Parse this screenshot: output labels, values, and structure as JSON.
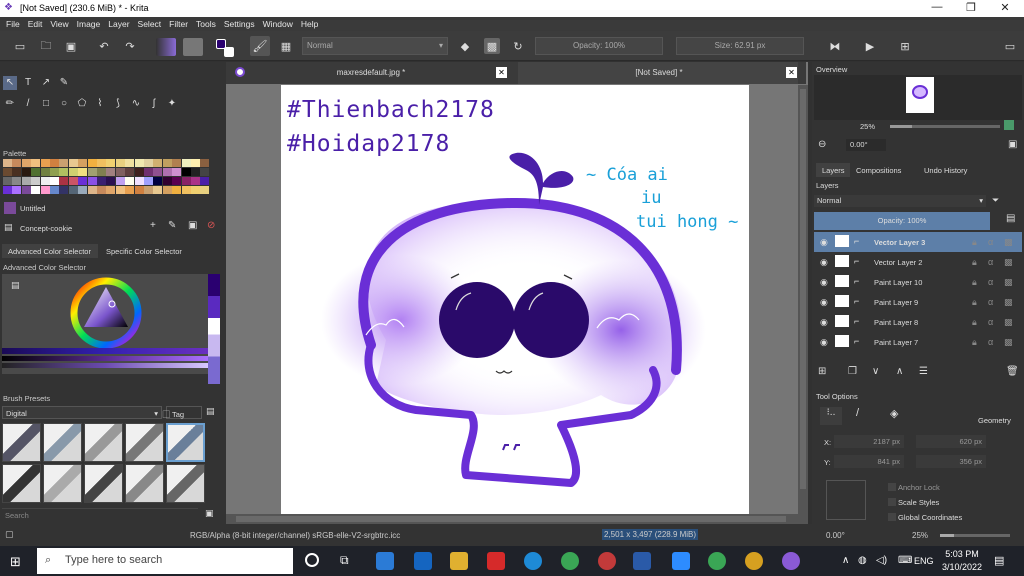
{
  "window": {
    "title": "[Not Saved]  (230.6 MiB)  * - Krita"
  },
  "menu": [
    "File",
    "Edit",
    "View",
    "Image",
    "Layer",
    "Select",
    "Filter",
    "Tools",
    "Settings",
    "Window",
    "Help"
  ],
  "toolbar": {
    "blend_mode": "Normal",
    "opacity": "Opacity: 100%",
    "size": "Size: 62.91 px"
  },
  "docker_palette": {
    "title": "Palette",
    "palette_name": "Untitled",
    "resource": "Concept-cookie"
  },
  "color_selector": {
    "tab1": "Advanced Color Selector",
    "tab2": "Specific Color Selector",
    "title": "Advanced Color Selector"
  },
  "brush_presets": {
    "title": "Brush Presets",
    "filter": "Digital",
    "tag": "Tag",
    "search": "Search"
  },
  "doc_tabs": [
    "maxresdefault.jpg *",
    "[Not Saved]  *"
  ],
  "artwork": {
    "line1": "#Thienbach2178",
    "line2": "#Hoidap2178",
    "line3": "~ Cóa ai",
    "line4": "iu",
    "line5": "tui hong ~"
  },
  "overview": {
    "title": "Overview",
    "zoom": "25%",
    "rotation": "0.00°"
  },
  "layers_panel": {
    "tabs": [
      "Layers",
      "Compositions",
      "Undo History"
    ],
    "title": "Layers",
    "blend": "Normal",
    "opacity": "Opacity:  100%",
    "layers": [
      {
        "name": "Vector Layer 3",
        "selected": true
      },
      {
        "name": "Vector Layer 2",
        "selected": false
      },
      {
        "name": "Paint Layer 10",
        "selected": false
      },
      {
        "name": "Paint Layer 9",
        "selected": false
      },
      {
        "name": "Paint Layer 8",
        "selected": false
      },
      {
        "name": "Paint Layer 7",
        "selected": false
      }
    ]
  },
  "tool_options": {
    "title": "Tool Options",
    "geometry": "Geometry",
    "x_label": "X:",
    "y_label": "Y:",
    "x": "2187 px",
    "y": "841 px",
    "w": "620 px",
    "h": "356 px",
    "anchor": "Anchor Lock",
    "scale": "Scale Styles",
    "global": "Global Coordinates"
  },
  "status": {
    "color_model": "RGB/Alpha (8-bit integer/channel)  sRGB-elle-V2-srgbtrc.icc",
    "dimensions": "2,501 x 3,497 (228.9 MiB)",
    "rotation": "0.00°",
    "zoom": "25%"
  },
  "taskbar": {
    "search": "Type here to search",
    "time": "5:03 PM",
    "date": "3/10/2022",
    "lang": "ENG"
  }
}
